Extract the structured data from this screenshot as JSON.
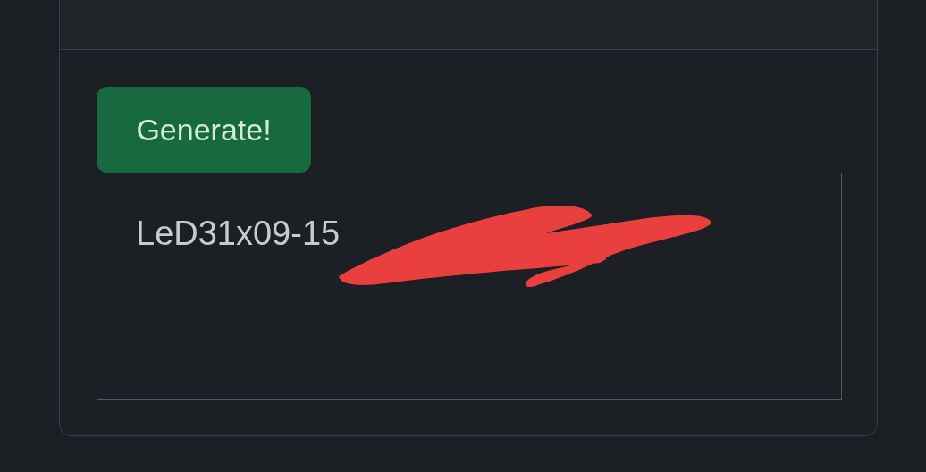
{
  "generate_button": {
    "label": "Generate!"
  },
  "output": {
    "value": "LeD31x09-15"
  }
}
